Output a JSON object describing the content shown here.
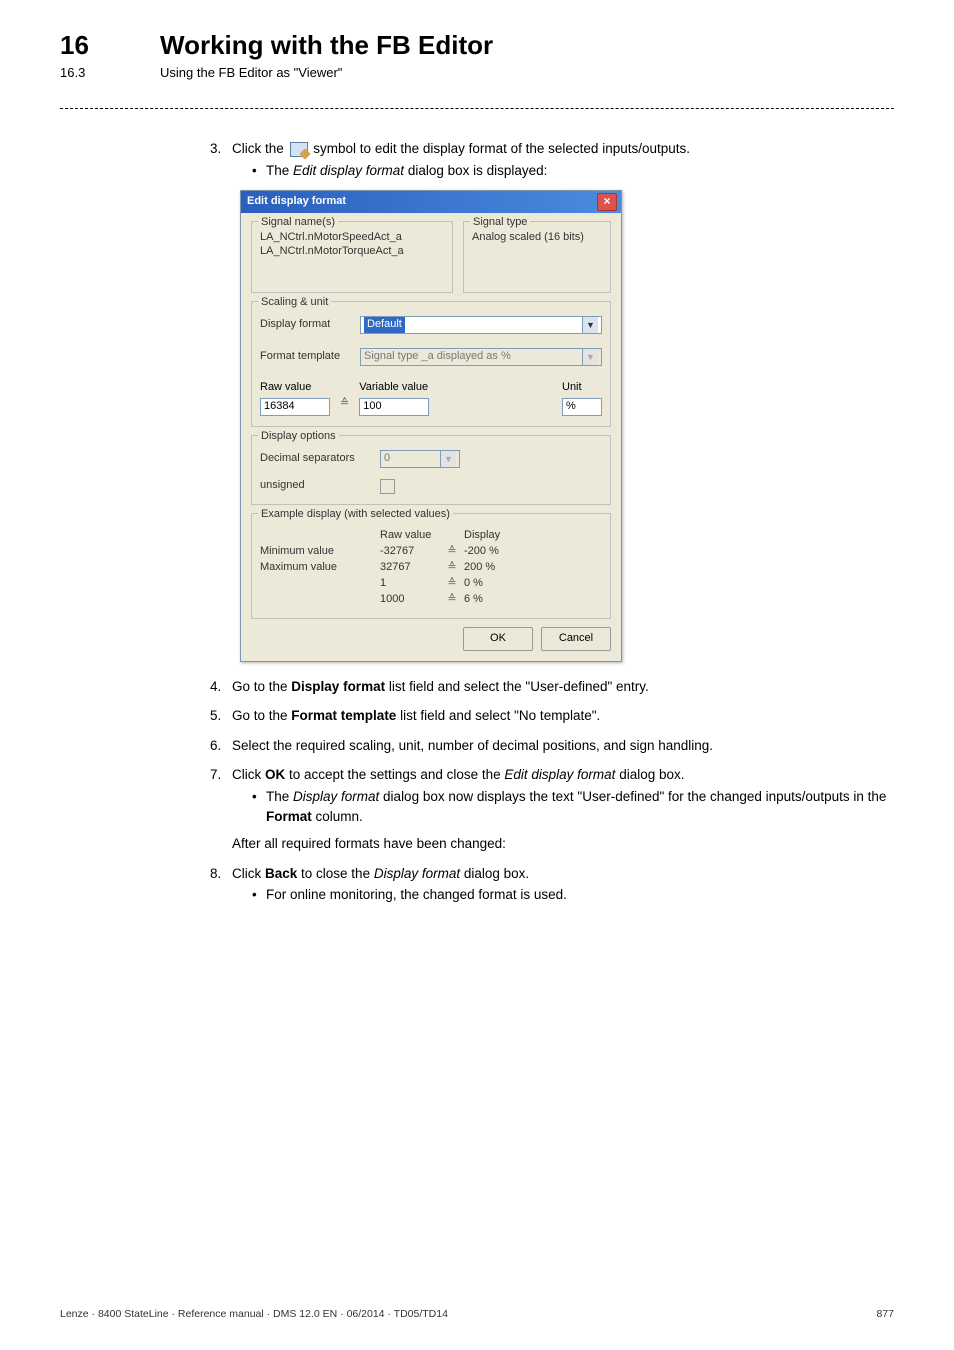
{
  "header": {
    "chapter_number": "16",
    "chapter_title": "Working with the FB Editor",
    "section_number": "16.3",
    "section_title": "Using the FB Editor as \"Viewer\""
  },
  "steps": {
    "s3": {
      "num": "3.",
      "text_before_icon": "Click the ",
      "text_after_icon": " symbol to edit the display format of the selected inputs/outputs.",
      "bullet": "The Edit display format dialog box is displayed:"
    },
    "s4": {
      "num": "4.",
      "pre": "Go to the ",
      "bold": "Display format",
      "post": " list field and select the \"User-defined\" entry."
    },
    "s5": {
      "num": "5.",
      "pre": "Go to the ",
      "bold": "Format template",
      "post": " list field and select \"No template\"."
    },
    "s6": {
      "num": "6.",
      "text": "Select the required scaling, unit, number of decimal positions, and sign handling."
    },
    "s7": {
      "num": "7.",
      "pre": "Click ",
      "bold": "OK",
      "post": " to accept the settings and close the Edit display format dialog box.",
      "bullet": "The Display format dialog box now displays the text \"User-defined\" for the changed inputs/outputs in the Format column."
    },
    "after7": "After all required formats have been changed:",
    "s8": {
      "num": "8.",
      "pre": "Click ",
      "bold": "Back",
      "post": " to close the Display format dialog box.",
      "bullet": "For online monitoring, the changed format is used."
    }
  },
  "dialog": {
    "title": "Edit display format",
    "close_icon": "×",
    "signal_names_legend": "Signal name(s)",
    "signal_names": [
      "LA_NCtrl.nMotorSpeedAct_a",
      "LA_NCtrl.nMotorTorqueAct_a"
    ],
    "signal_type_legend": "Signal type",
    "signal_type_value": "Analog scaled (16 bits)",
    "scaling_legend": "Scaling & unit",
    "display_format_label": "Display format",
    "display_format_value": "Default",
    "format_template_label": "Format template",
    "format_template_value": "Signal type _a displayed as %",
    "raw_value_label": "Raw value",
    "raw_value_value": "16384",
    "equals": "≙",
    "variable_value_label": "Variable value",
    "variable_value_value": "100",
    "unit_label": "Unit",
    "unit_value": "%",
    "display_options_legend": "Display options",
    "decimal_sep_label": "Decimal separators",
    "decimal_sep_value": "0",
    "unsigned_label": "unsigned",
    "example_legend": "Example display (with selected values)",
    "example_headers": {
      "raw": "Raw value",
      "display": "Display"
    },
    "example_rows": [
      {
        "label": "Minimum value",
        "raw": "-32767",
        "display": "-200 %"
      },
      {
        "label": "Maximum value",
        "raw": "32767",
        "display": "200 %"
      },
      {
        "label": "",
        "raw": "1",
        "display": "0 %"
      },
      {
        "label": "",
        "raw": "1000",
        "display": "6 %"
      }
    ],
    "ok": "OK",
    "cancel": "Cancel"
  },
  "footer": {
    "left": "Lenze · 8400 StateLine · Reference manual · DMS 12.0 EN · 06/2014 · TD05/TD14",
    "right": "877"
  }
}
